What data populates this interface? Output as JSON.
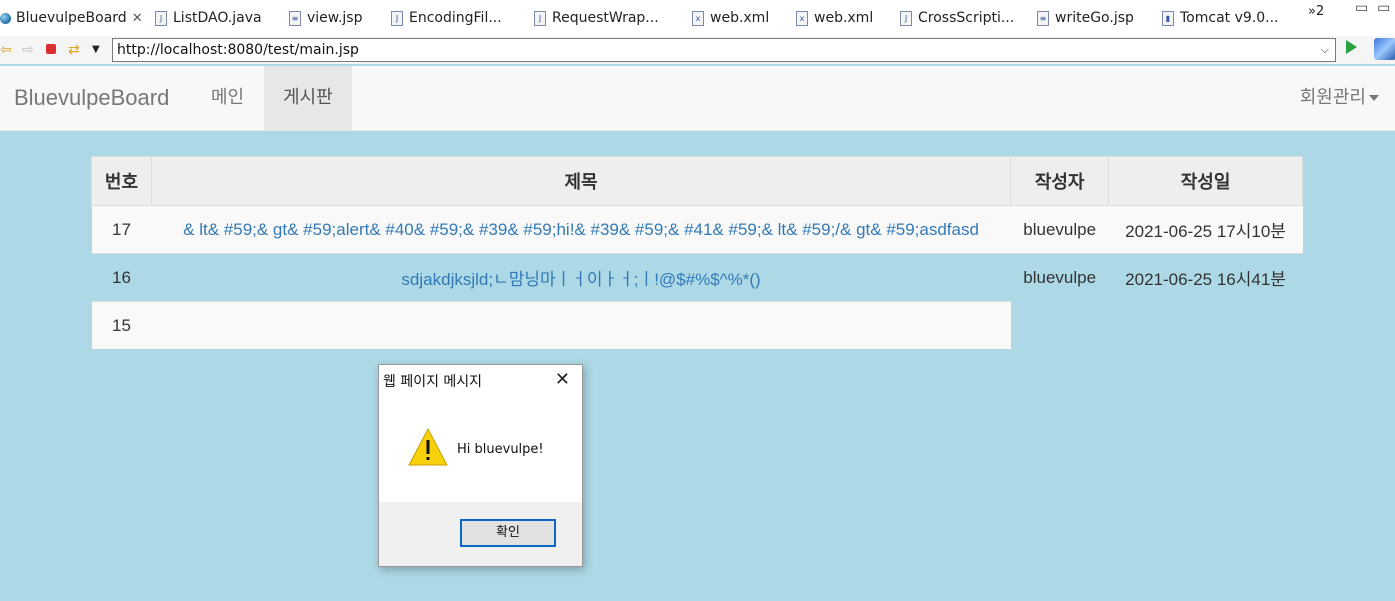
{
  "tabs": [
    {
      "label": "BluevulpeBoard",
      "closable": true,
      "icon": "globe-icon"
    },
    {
      "label": "ListDAO.java",
      "icon": "java-file-icon"
    },
    {
      "label": "view.jsp",
      "icon": "jsp-file-icon"
    },
    {
      "label": "EncodingFil...",
      "icon": "java-file-icon"
    },
    {
      "label": "RequestWrap...",
      "icon": "java-file-icon"
    },
    {
      "label": "web.xml",
      "icon": "xml-file-icon"
    },
    {
      "label": "web.xml",
      "icon": "xml-file-icon"
    },
    {
      "label": "CrossScripti...",
      "icon": "java-file-icon"
    },
    {
      "label": "writeGo.jsp",
      "icon": "jsp-file-icon"
    },
    {
      "label": "Tomcat v9.0...",
      "icon": "server-icon"
    }
  ],
  "tab_overflow": "»2",
  "address_bar": {
    "url": "http://localhost:8080/test/main.jsp"
  },
  "navbar": {
    "brand": "BluevulpeBoard",
    "items": [
      {
        "label": "메인",
        "active": false
      },
      {
        "label": "게시판",
        "active": true
      }
    ],
    "dropdown_label": "회원관리"
  },
  "board": {
    "headers": [
      "번호",
      "제목",
      "작성자",
      "작성일"
    ],
    "rows": [
      {
        "num": "17",
        "title": "& lt& #59;& gt& #59;alert& #40& #59;& #39& #59;hi!& #39& #59;& #41& #59;& lt& #59;/& gt& #59;asdfasd",
        "author": "bluevulpe",
        "date": "2021-06-25 17시10분"
      },
      {
        "num": "16",
        "title": "sdjakdjksjld;ㄴ맘닝마ㅣㅓ이ㅏㅓ;ㅣ!@$#%$^%*()",
        "author": "bluevulpe",
        "date": "2021-06-25 16시41분"
      },
      {
        "num": "15",
        "title": "",
        "author": "",
        "date": ""
      }
    ]
  },
  "dialog": {
    "title": "웹 페이지 메시지",
    "message": "Hi bluevulpe!",
    "ok_label": "확인",
    "icon": "warning-icon"
  },
  "colors": {
    "page_bg": "#add8e6",
    "link": "#337ab7",
    "navbar_bg": "#f8f8f8",
    "dialog_ok_border": "#0a66c8"
  }
}
